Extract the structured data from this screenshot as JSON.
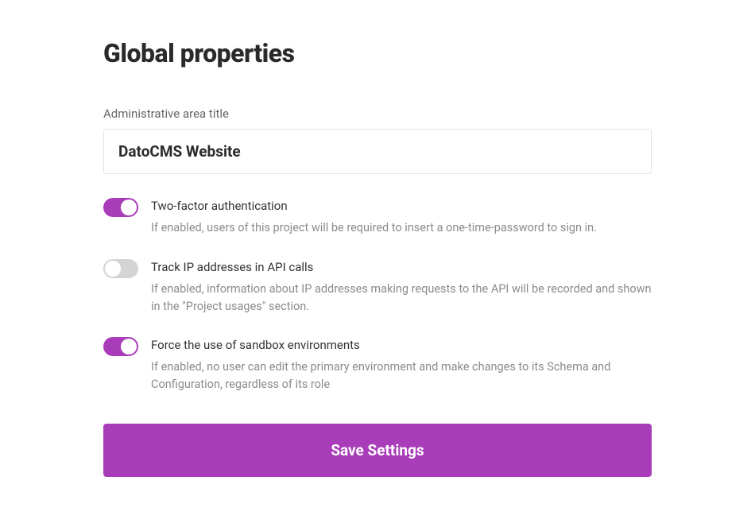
{
  "page": {
    "title": "Global properties"
  },
  "form": {
    "admin_title_label": "Administrative area title",
    "admin_title_value": "DatoCMS Website",
    "toggles": {
      "two_factor": {
        "title": "Two-factor authentication",
        "description": "If enabled, users of this project will be required to insert a one-time-password to sign in.",
        "enabled": true
      },
      "track_ip": {
        "title": "Track IP addresses in API calls",
        "description": "If enabled, information about IP addresses making requests to the API will be recorded and shown in the \"Project usages\" section.",
        "enabled": false
      },
      "sandbox": {
        "title": "Force the use of sandbox environments",
        "description": "If enabled, no user can edit the primary environment and make changes to its Schema and Configuration, regardless of its role",
        "enabled": true
      }
    },
    "save_button_label": "Save Settings"
  },
  "colors": {
    "accent": "#a93db9"
  }
}
